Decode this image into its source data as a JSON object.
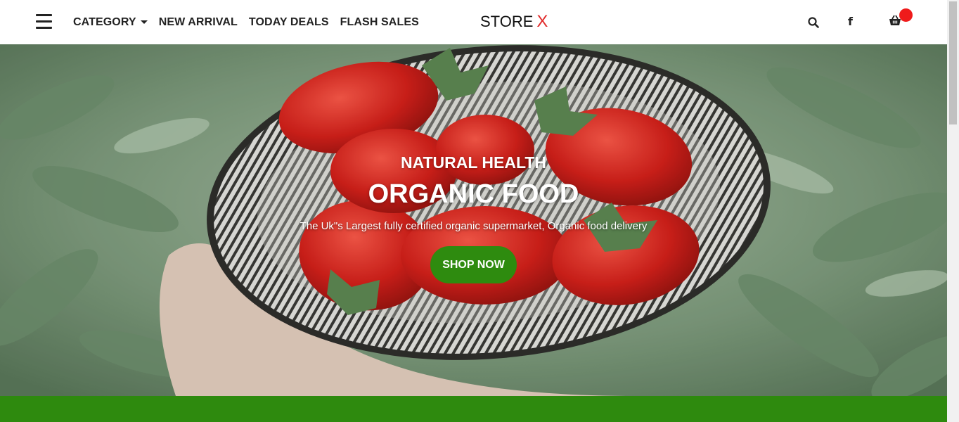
{
  "header": {
    "nav": {
      "category": "CATEGORY",
      "new_arrival": "NEW ARRIVAL",
      "today_deals": "TODAY DEALS",
      "flash_sales": "FLASH SALES"
    },
    "logo": {
      "text": "STORE",
      "mark": "X"
    },
    "icons": [
      "menu-icon",
      "search-icon",
      "facebook-icon",
      "cart-icon"
    ],
    "facebook_glyph": "f"
  },
  "hero": {
    "subtitle": "NATURAL HEALTH",
    "title": "ORGANIC FOOD",
    "description": "The Uk\"s Largest fully certified organic supermarket, Organic food delivery",
    "button_label": "SHOP NOW"
  },
  "colors": {
    "accent_green": "#2e8b0f",
    "logo_x_red": "#e12b2b",
    "cart_badge_red": "#ef1b1b"
  }
}
